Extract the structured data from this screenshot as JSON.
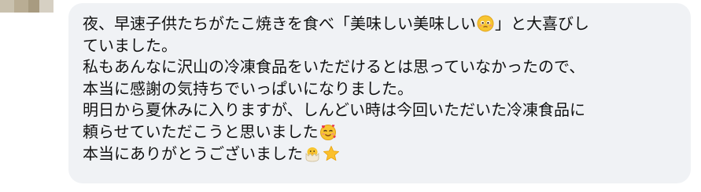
{
  "comment": {
    "lines": [
      {
        "parts": [
          {
            "t": "夜、早速子供たちがたこ焼きを食べ「美味しい美味しい"
          },
          {
            "e": "pleading-face"
          },
          {
            "t": "」と大喜びし"
          }
        ]
      },
      {
        "parts": [
          {
            "t": "ていました。"
          }
        ]
      },
      {
        "parts": [
          {
            "t": "私もあんなに沢山の冷凍食品をいただけるとは思っていなかったので、"
          }
        ]
      },
      {
        "parts": [
          {
            "t": "本当に感謝の気持ちでいっぱいになりました。"
          }
        ]
      },
      {
        "parts": [
          {
            "t": "明日から夏休みに入りますが、しんどい時は今回いただいた冷凍食品に"
          }
        ]
      },
      {
        "parts": [
          {
            "t": "頼らせていただこうと思いました"
          },
          {
            "e": "smiling-face-with-hearts"
          }
        ]
      },
      {
        "parts": [
          {
            "t": "本当にありがとうございました"
          },
          {
            "e": "hatching-chick"
          },
          {
            "e": "star"
          }
        ]
      }
    ]
  },
  "colors": {
    "bubble_bg": "#f0f2f5",
    "text": "#111111",
    "avatar_blocks": [
      "#c9c1ae",
      "#b9ad94",
      "#a89b80",
      "#d6d0c3"
    ]
  }
}
